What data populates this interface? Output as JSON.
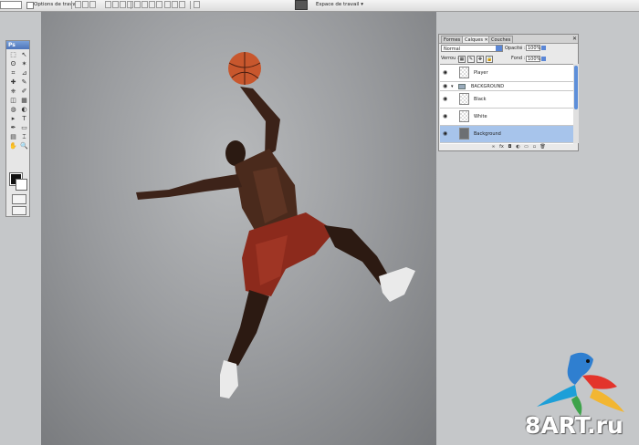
{
  "optionsbar": {
    "mode_value": "",
    "auto_select_label": "Options de travail",
    "workspace_label": "Espace de travail"
  },
  "toolbox": {
    "header": "Ps",
    "tools": [
      "marquee-icon",
      "move-icon",
      "lasso-icon",
      "magic-wand-icon",
      "crop-icon",
      "slice-icon",
      "healing-icon",
      "brush-icon",
      "stamp-icon",
      "history-brush-icon",
      "eraser-icon",
      "gradient-icon",
      "blur-icon",
      "dodge-icon",
      "path-select-icon",
      "type-icon",
      "pen-icon",
      "shape-icon",
      "notes-icon",
      "eyedropper-icon",
      "hand-icon",
      "zoom-icon"
    ],
    "tool_glyphs": [
      "⬚",
      "↖",
      "ʘ",
      "✶",
      "⌗",
      "⊿",
      "✚",
      "✎",
      "⎈",
      "✐",
      "◫",
      "▦",
      "◍",
      "◐",
      "▸",
      "T",
      "✒",
      "▭",
      "▤",
      "⌶",
      "✋",
      "🔍"
    ],
    "foreground_color": "#111111",
    "background_color": "#ffffff"
  },
  "layers_panel": {
    "tabs": [
      "Formes",
      "Calques",
      "Couches"
    ],
    "active_tab": "Calques",
    "close_glyph": "✕",
    "blend_mode": "Normal",
    "opacity_label": "Opacité :",
    "opacity_value": "100%",
    "lock_label": "Verrou :",
    "fill_label": "Fond :",
    "fill_value": "100%",
    "layers": [
      {
        "name": "Player",
        "type": "layer",
        "visible": true,
        "selected": false
      },
      {
        "name": "BACKGROUND",
        "type": "group",
        "visible": true,
        "selected": false
      },
      {
        "name": "Black",
        "type": "layer",
        "visible": true,
        "selected": false
      },
      {
        "name": "White",
        "type": "layer",
        "visible": true,
        "selected": false
      },
      {
        "name": "Background",
        "type": "layer",
        "visible": true,
        "selected": true
      }
    ],
    "footer_icons": [
      "link-icon",
      "fx-icon",
      "mask-icon",
      "adjustment-icon",
      "new-group-icon",
      "new-layer-icon",
      "trash-icon"
    ],
    "footer_glyphs": [
      "∞",
      "fx",
      "◘",
      "◐",
      "▭",
      "▫",
      "🗑"
    ]
  },
  "watermark": {
    "text": "8ART.ru"
  },
  "colors": {
    "accent": "#5b87d6",
    "selected_row": "#a7c4eb"
  }
}
